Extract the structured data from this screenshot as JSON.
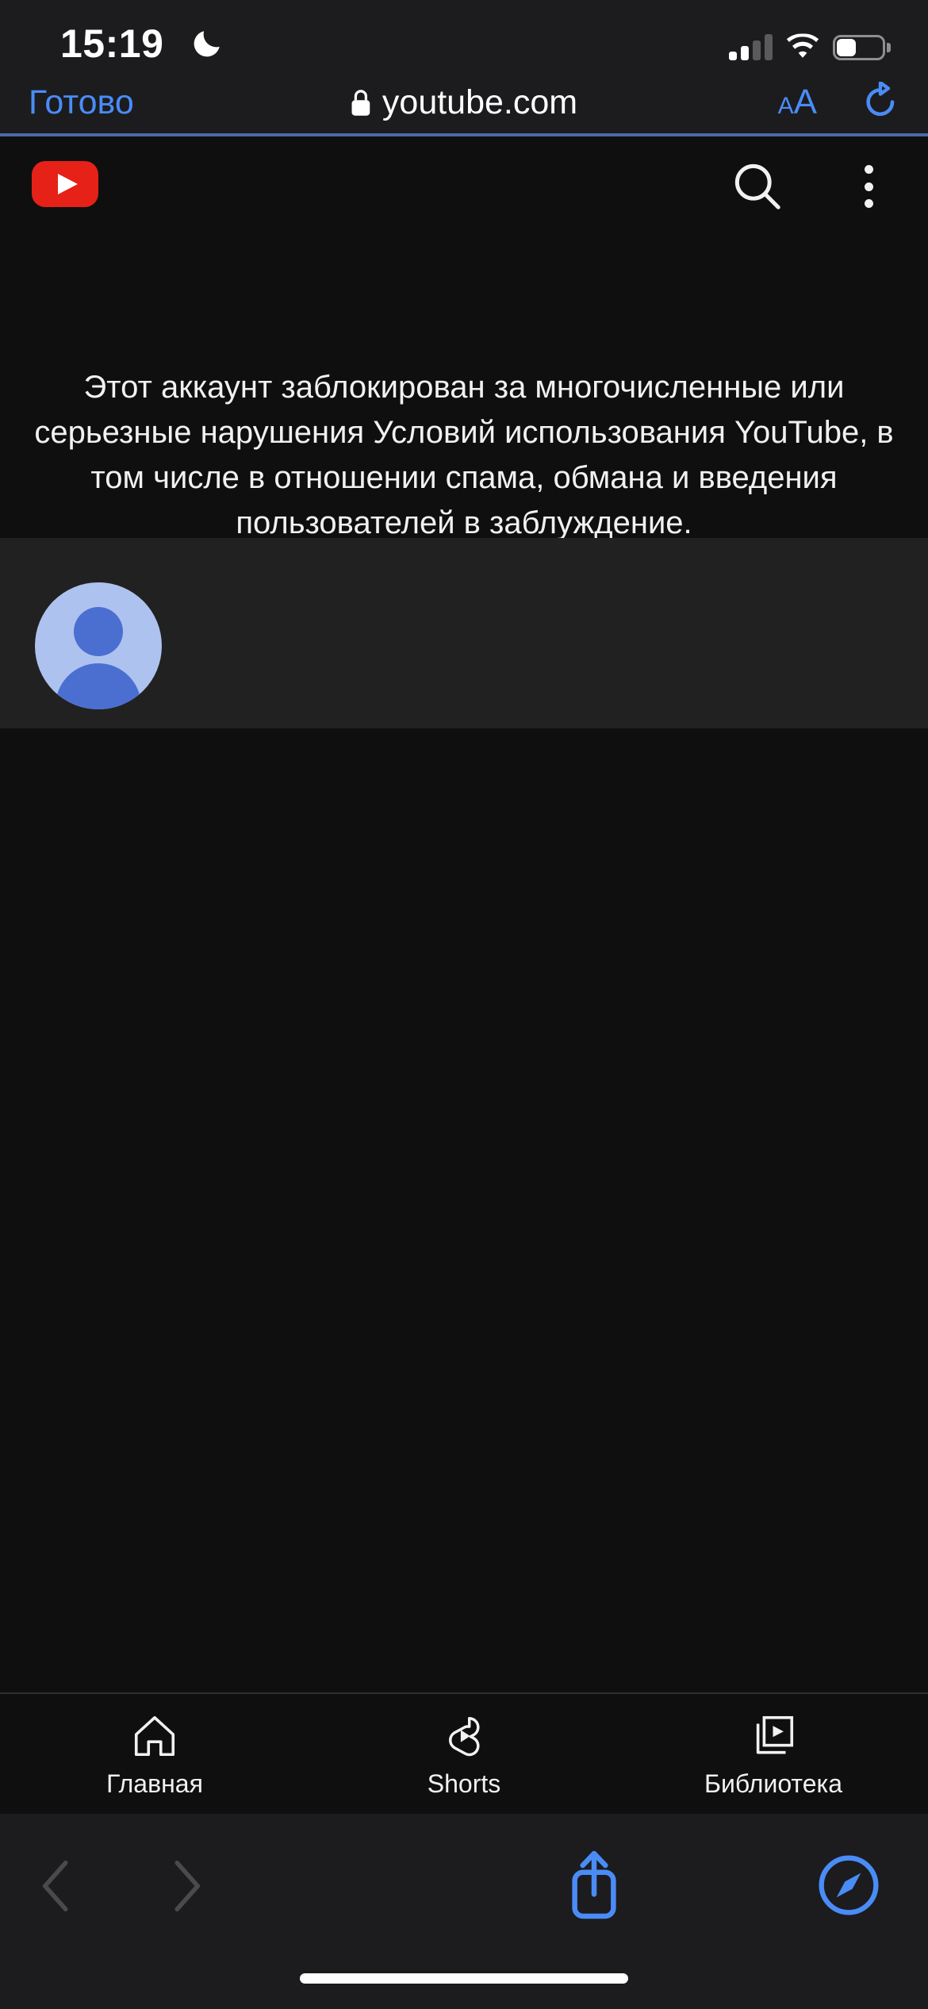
{
  "status_bar": {
    "time": "15:19",
    "moon_icon": "crescent-moon-icon",
    "signal_icon": "cellular-signal-icon",
    "wifi_icon": "wifi-icon",
    "battery_icon": "battery-icon",
    "battery_level_percent": 40,
    "signal_bars_active": 2,
    "signal_bars_total": 4
  },
  "safari_top": {
    "done_label": "Готово",
    "lock_icon": "lock-icon",
    "url": "youtube.com",
    "text_size_small": "A",
    "text_size_big": "A",
    "text_size_icon": "text-size-icon",
    "reload_icon": "reload-icon",
    "progress_color": "#4a6ba8",
    "accent_color": "#4a8cf7"
  },
  "youtube_header": {
    "logo_icon": "youtube-logo-icon",
    "logo_color": "#e62117",
    "search_icon": "search-icon",
    "menu_icon": "kebab-menu-icon"
  },
  "warning": {
    "message": "Этот аккаунт заблокирован за многочисленные или серьезные нарушения Условий использования YouTube, в том числе в отношении спама, обмана и введения пользователей в заблуждение."
  },
  "channel": {
    "avatar_icon": "default-avatar-icon",
    "avatar_bg_color": "#aec2ef",
    "avatar_fg_color": "#4a6fd1",
    "banner_bg_color": "#212121"
  },
  "bottom_nav": {
    "items": [
      {
        "label": "Главная",
        "icon": "home-icon"
      },
      {
        "label": "Shorts",
        "icon": "shorts-icon"
      },
      {
        "label": "Библиотека",
        "icon": "library-icon"
      }
    ]
  },
  "safari_bottom": {
    "back_icon": "chevron-left-icon",
    "forward_icon": "chevron-right-icon",
    "share_icon": "share-icon",
    "tabs_icon": "safari-compass-icon",
    "disabled_color": "#4a4a4d",
    "enabled_color": "#4a8cf7",
    "home_indicator": "home-indicator"
  }
}
